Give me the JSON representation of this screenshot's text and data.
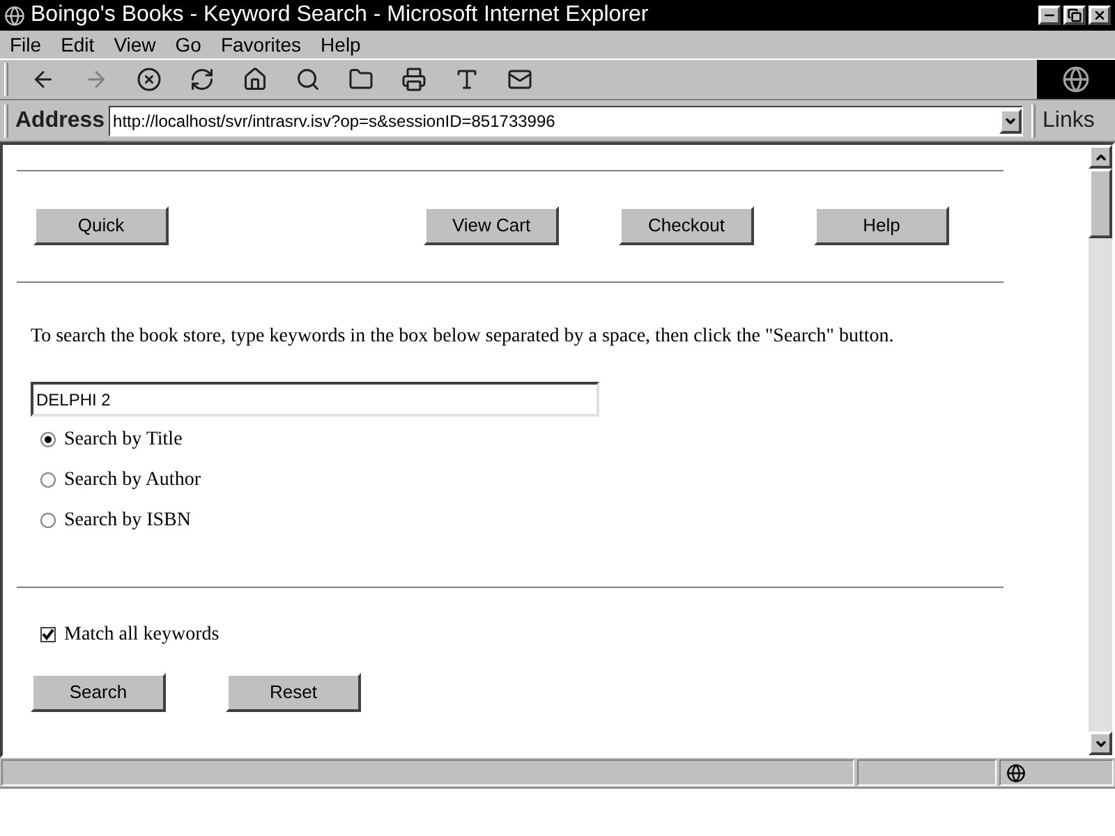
{
  "window": {
    "title": "Boingo's Books - Keyword Search - Microsoft Internet Explorer"
  },
  "menu": [
    "File",
    "Edit",
    "View",
    "Go",
    "Favorites",
    "Help"
  ],
  "address_bar": {
    "label": "Address",
    "url": "http://localhost/svr/intrasrv.isv?op=s&sessionID=851733996",
    "links": "Links"
  },
  "nav_buttons": [
    "Quick",
    "View Cart",
    "Checkout",
    "Help"
  ],
  "instructions": "To search the book store, type keywords in the box below separated by a space, then click the \"Search\" button.",
  "search_field": {
    "value": "DELPHI 2"
  },
  "search_options": [
    {
      "label": "Search by Title",
      "selected": true
    },
    {
      "label": "Search by Author",
      "selected": false
    },
    {
      "label": "Search by ISBN",
      "selected": false
    }
  ],
  "match_all": {
    "label": "Match all keywords",
    "checked": true
  },
  "form_buttons": [
    "Search",
    "Reset"
  ]
}
